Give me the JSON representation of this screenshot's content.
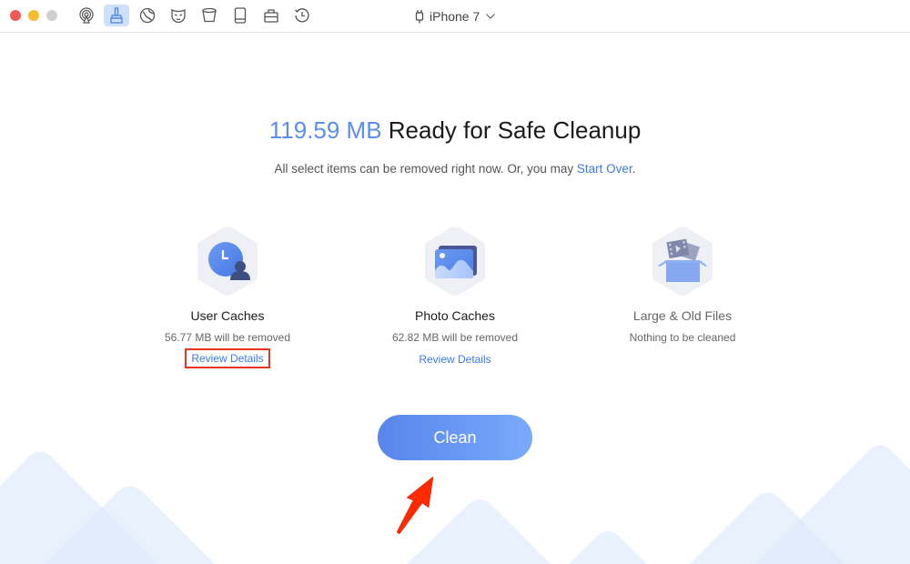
{
  "window": {
    "traffic_lights": [
      "close",
      "minimize",
      "maximize"
    ]
  },
  "toolbar": {
    "tools": [
      {
        "name": "airplay-icon",
        "active": false
      },
      {
        "name": "cleaner-brush-icon",
        "active": true
      },
      {
        "name": "globe-icon",
        "active": false
      },
      {
        "name": "mask-privacy-icon",
        "active": false
      },
      {
        "name": "trash-bucket-icon",
        "active": false
      },
      {
        "name": "phone-icon",
        "active": false
      },
      {
        "name": "toolbox-icon",
        "active": false
      },
      {
        "name": "history-clock-icon",
        "active": false
      }
    ],
    "device_name": "iPhone 7"
  },
  "main": {
    "size_value": "119.59 MB",
    "headline_rest": " Ready for Safe Cleanup",
    "subline_text": "All select items can be removed right now. Or, you may ",
    "start_over_link": "Start Over",
    "subline_end": ".",
    "categories": [
      {
        "title": "User Caches",
        "status": "56.77 MB will be removed",
        "link": "Review Details",
        "icon": "user-caches-icon"
      },
      {
        "title": "Photo Caches",
        "status": "62.82 MB will be removed",
        "link": "Review Details",
        "icon": "photo-caches-icon"
      },
      {
        "title": "Large & Old Files",
        "status": "Nothing to be cleaned",
        "link": null,
        "icon": "large-old-files-icon"
      }
    ],
    "clean_button": "Clean"
  },
  "colors": {
    "accent": "#5b8def",
    "link": "#3b7be6",
    "highlight_annotation": "#e8341c",
    "button_gradient_start": "#5785ec",
    "button_gradient_end": "#7aa9fb"
  }
}
